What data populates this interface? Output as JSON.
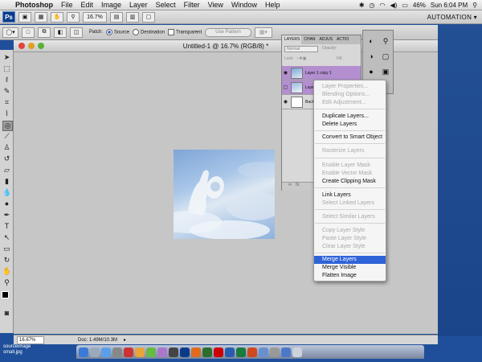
{
  "menubar": {
    "app_name": "Photoshop",
    "items": [
      "File",
      "Edit",
      "Image",
      "Layer",
      "Select",
      "Filter",
      "View",
      "Window",
      "Help"
    ],
    "battery": "46%",
    "clock": "Sun 6:04 PM"
  },
  "appbar": {
    "ps_logo": "Ps",
    "zoom_value": "16.7%",
    "workspace_label": "AUTOMATION ▾"
  },
  "options_bar": {
    "patch_label": "Patch:",
    "source_label": "Source",
    "destination_label": "Destination",
    "transparent_label": "Transparent",
    "use_pattern_label": "Use Pattern"
  },
  "document": {
    "title": "Untitled-1 @ 16.7% (RGB/8) *",
    "status_zoom": "16.67%",
    "status_doc": "Doc: 1.49M/10.3M"
  },
  "layers_panel": {
    "tabs": [
      "LAYERS",
      "CHAN",
      "ADJUS",
      "ACTIO"
    ],
    "blend_mode": "Normal",
    "opacity_label": "Opacity:",
    "lock_label": "Lock:",
    "fill_label": "Fill:",
    "layers": [
      {
        "name": "Layer 1 copy 1",
        "selected": true
      },
      {
        "name": "Layer 1",
        "selected": true
      },
      {
        "name": "Background",
        "selected": false
      }
    ]
  },
  "context_menu": {
    "items": [
      {
        "label": "Layer Properties...",
        "enabled": false
      },
      {
        "label": "Blending Options...",
        "enabled": false
      },
      {
        "label": "Edit Adjustment...",
        "enabled": false
      },
      {
        "label": "Duplicate Layers...",
        "enabled": true
      },
      {
        "label": "Delete Layers",
        "enabled": true
      },
      {
        "label": "Convert to Smart Object",
        "enabled": true
      },
      {
        "label": "Rasterize Layers",
        "enabled": false
      },
      {
        "label": "Enable Layer Mask",
        "enabled": false
      },
      {
        "label": "Enable Vector Mask",
        "enabled": false
      },
      {
        "label": "Create Clipping Mask",
        "enabled": true
      },
      {
        "label": "Link Layers",
        "enabled": true
      },
      {
        "label": "Select Linked Layers",
        "enabled": false
      },
      {
        "label": "Select Similar Layers",
        "enabled": false
      },
      {
        "label": "Copy Layer Style",
        "enabled": false
      },
      {
        "label": "Paste Layer Style",
        "enabled": false
      },
      {
        "label": "Clear Layer Style",
        "enabled": false
      },
      {
        "label": "Merge Layers",
        "enabled": true,
        "highlighted": true
      },
      {
        "label": "Merge Visible",
        "enabled": true
      },
      {
        "label": "Flatten Image",
        "enabled": true
      }
    ]
  },
  "desktop": {
    "file_label": "sourceimage small.jpg"
  },
  "colors": {
    "desktop_blue": "#1f4f9a",
    "selection_blue": "#2f63d8",
    "layer_selected": "#b48fd0",
    "photoshop_blue": "#0a3b8a"
  }
}
